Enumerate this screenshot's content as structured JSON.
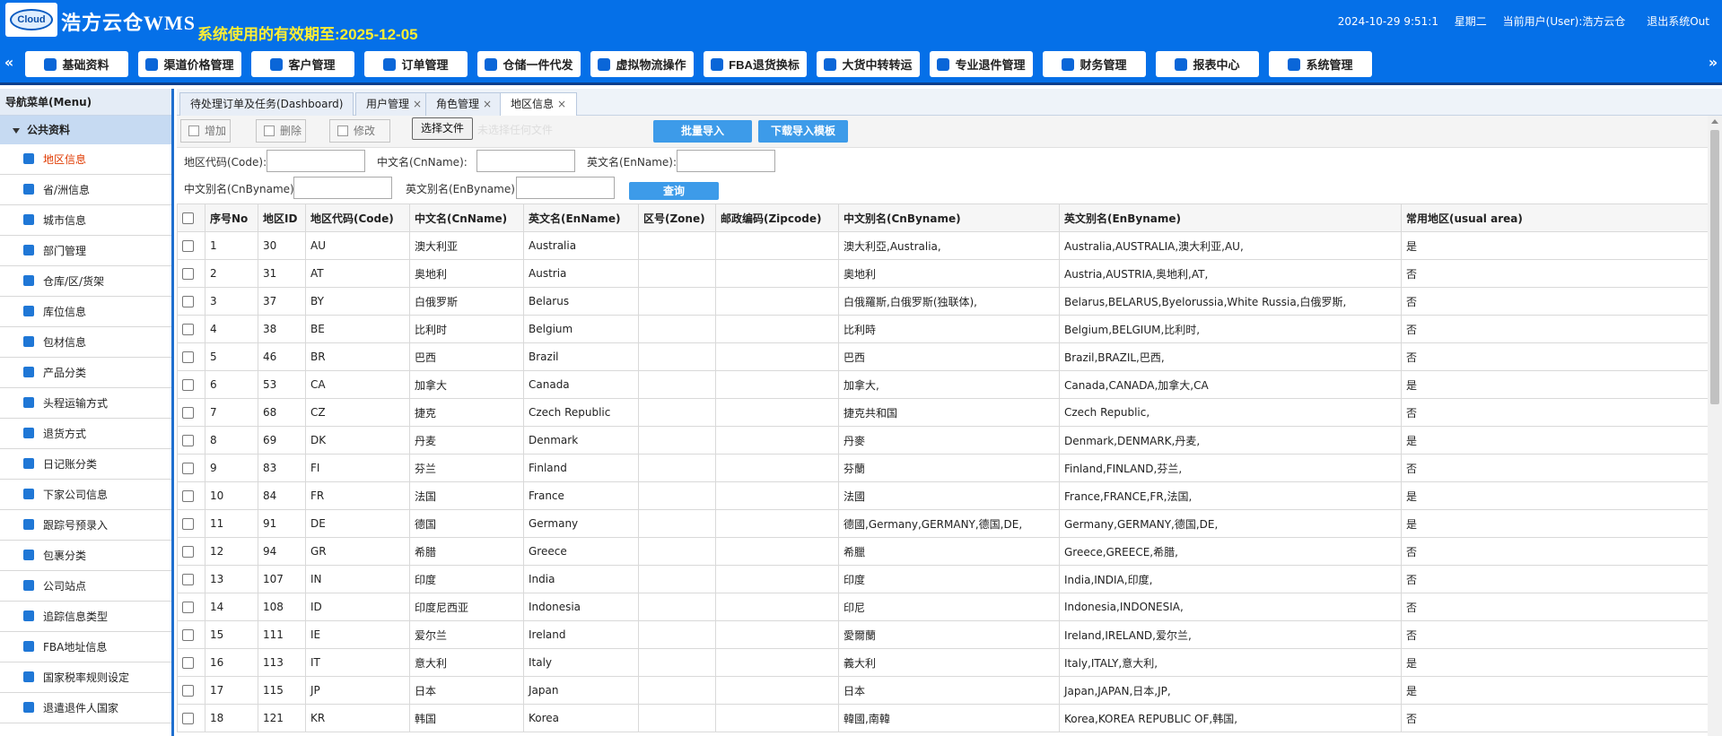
{
  "header": {
    "logo_text": "Cloud",
    "brand": "浩方云仓WMS",
    "expiry": "系统使用的有效期至:2025-12-05",
    "datetime": "2024-10-29 9:51:1",
    "weekday": "星期二",
    "current_user": "当前用户(User):浩方云仓",
    "logout": "退出系统Out"
  },
  "nav": {
    "left_arrow": "«",
    "right_arrow": "»",
    "buttons": [
      {
        "label": "基础资料"
      },
      {
        "label": "渠道价格管理"
      },
      {
        "label": "客户管理"
      },
      {
        "label": "订单管理"
      },
      {
        "label": "仓储一件代发"
      },
      {
        "label": "虚拟物流操作"
      },
      {
        "label": "FBA退货换标"
      },
      {
        "label": "大货中转转运"
      },
      {
        "label": "专业退件管理"
      },
      {
        "label": "财务管理"
      },
      {
        "label": "报表中心"
      },
      {
        "label": "系统管理"
      }
    ]
  },
  "sidebar": {
    "title": "导航菜单(Menu)",
    "group": "公共资料",
    "items": [
      {
        "label": "地区信息"
      },
      {
        "label": "省/洲信息"
      },
      {
        "label": "城市信息"
      },
      {
        "label": "部门管理"
      },
      {
        "label": "仓库/区/货架"
      },
      {
        "label": "库位信息"
      },
      {
        "label": "包材信息"
      },
      {
        "label": "产品分类"
      },
      {
        "label": "头程运输方式"
      },
      {
        "label": "退货方式"
      },
      {
        "label": "日记账分类"
      },
      {
        "label": "下家公司信息"
      },
      {
        "label": "跟踪号预录入"
      },
      {
        "label": "包裹分类"
      },
      {
        "label": "公司站点"
      },
      {
        "label": "追踪信息类型"
      },
      {
        "label": "FBA地址信息"
      },
      {
        "label": "国家税率规则设定"
      },
      {
        "label": "退遣退件人国家"
      }
    ]
  },
  "tabs": [
    {
      "label": "待处理订单及任务(Dashboard)"
    },
    {
      "label": "用户管理"
    },
    {
      "label": "角色管理"
    },
    {
      "label": "地区信息"
    }
  ],
  "tab_close": "×",
  "toolbar": {
    "add": "增加",
    "delete": "删除",
    "edit": "修改",
    "choose_file": "选择文件",
    "no_file": "未选择任何文件",
    "batch_import": "批量导入",
    "download_template": "下载导入模板"
  },
  "search": {
    "code_label": "地区代码(Code):",
    "cnname_label": "中文名(CnName):",
    "enname_label": "英文名(EnName):",
    "cnbyname_label": "中文别名(CnByname):",
    "enbyname_label": "英文别名(EnByname):",
    "query_button": "查询"
  },
  "grid": {
    "columns": [
      "序号No",
      "地区ID",
      "地区代码(Code)",
      "中文名(CnName)",
      "英文名(EnName)",
      "区号(Zone)",
      "邮政编码(Zipcode)",
      "中文别名(CnByname)",
      "英文别名(EnByname)",
      "常用地区(usual area)"
    ],
    "rows": [
      [
        "1",
        "30",
        "AU",
        "澳大利亚",
        "Australia",
        "",
        "",
        "澳大利亞,Australia,",
        "Australia,AUSTRALIA,澳大利亚,AU,",
        "是"
      ],
      [
        "2",
        "31",
        "AT",
        "奥地利",
        "Austria",
        "",
        "",
        "奧地利",
        "Austria,AUSTRIA,奥地利,AT,",
        "否"
      ],
      [
        "3",
        "37",
        "BY",
        "白俄罗斯",
        "Belarus",
        "",
        "",
        "白俄羅斯,白俄罗斯(独联体),",
        "Belarus,BELARUS,Byelorussia,White Russia,白俄罗斯,",
        "否"
      ],
      [
        "4",
        "38",
        "BE",
        "比利时",
        "Belgium",
        "",
        "",
        "比利時",
        "Belgium,BELGIUM,比利时,",
        "否"
      ],
      [
        "5",
        "46",
        "BR",
        "巴西",
        "Brazil",
        "",
        "",
        "巴西",
        "Brazil,BRAZIL,巴西,",
        "否"
      ],
      [
        "6",
        "53",
        "CA",
        "加拿大",
        "Canada",
        "",
        "",
        "加拿大,",
        "Canada,CANADA,加拿大,CA",
        "是"
      ],
      [
        "7",
        "68",
        "CZ",
        "捷克",
        "Czech Republic",
        "",
        "",
        "捷克共和国",
        "Czech Republic,",
        "否"
      ],
      [
        "8",
        "69",
        "DK",
        "丹麦",
        "Denmark",
        "",
        "",
        "丹麥",
        "Denmark,DENMARK,丹麦,",
        "是"
      ],
      [
        "9",
        "83",
        "FI",
        "芬兰",
        "Finland",
        "",
        "",
        "芬蘭",
        "Finland,FINLAND,芬兰,",
        "否"
      ],
      [
        "10",
        "84",
        "FR",
        "法国",
        "France",
        "",
        "",
        "法國",
        "France,FRANCE,FR,法国,",
        "是"
      ],
      [
        "11",
        "91",
        "DE",
        "德国",
        "Germany",
        "",
        "",
        "德國,Germany,GERMANY,德国,DE,",
        "Germany,GERMANY,德国,DE,",
        "是"
      ],
      [
        "12",
        "94",
        "GR",
        "希腊",
        "Greece",
        "",
        "",
        "希臘",
        "Greece,GREECE,希腊,",
        "否"
      ],
      [
        "13",
        "107",
        "IN",
        "印度",
        "India",
        "",
        "",
        "印度",
        "India,INDIA,印度,",
        "否"
      ],
      [
        "14",
        "108",
        "ID",
        "印度尼西亚",
        "Indonesia",
        "",
        "",
        "印尼",
        "Indonesia,INDONESIA,",
        "否"
      ],
      [
        "15",
        "111",
        "IE",
        "爱尔兰",
        "Ireland",
        "",
        "",
        "愛爾蘭",
        "Ireland,IRELAND,爱尔兰,",
        "否"
      ],
      [
        "16",
        "113",
        "IT",
        "意大利",
        "Italy",
        "",
        "",
        "義大利",
        "Italy,ITALY,意大利,",
        "是"
      ],
      [
        "17",
        "115",
        "JP",
        "日本",
        "Japan",
        "",
        "",
        "日本",
        "Japan,JAPAN,日本,JP,",
        "是"
      ],
      [
        "18",
        "121",
        "KR",
        "韩国",
        "Korea",
        "",
        "",
        "韓國,南韓",
        "Korea,KOREA REPUBLIC OF,韩国,",
        "否"
      ]
    ]
  }
}
